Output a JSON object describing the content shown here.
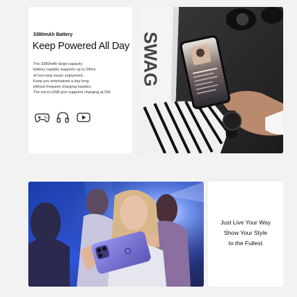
{
  "battery_panel": {
    "subtitle": "3380mAh Battery",
    "title": "Keep Powered All Day",
    "body_lines": [
      "The 3380mAh large-capacity",
      "battery capably supports up to 24hrs",
      "of non-stop music enjoyment.",
      "Keep you entertained a day long",
      "without frequent charging hassles.",
      "The micro-USB port supports charging at 5W."
    ],
    "icons": [
      "gamepad-icon",
      "headphones-icon",
      "video-play-icon"
    ]
  },
  "photo_top": {
    "box_text": "SWAG"
  },
  "style_panel": {
    "lines": [
      "Just Live Your Way",
      "Show Your Style",
      "to the Fullest"
    ]
  },
  "colors": {
    "background": "#f2f2f2",
    "card": "#ffffff",
    "phone_purple": "#6a64c8",
    "stage_blue": "#2440b0"
  }
}
